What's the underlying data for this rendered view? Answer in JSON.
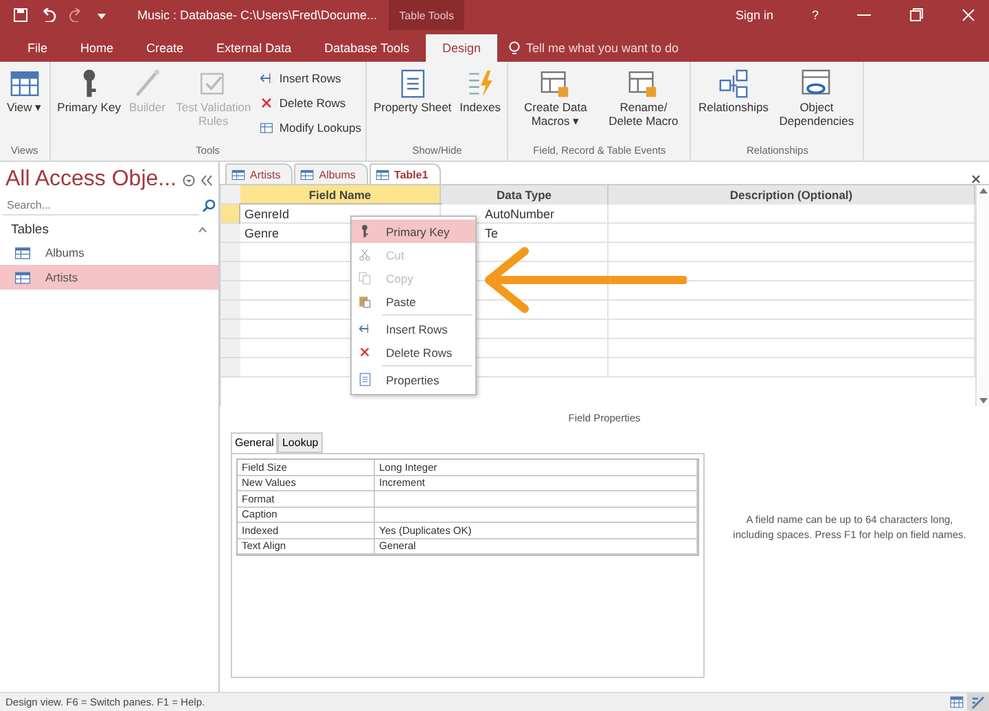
{
  "title_bar": {
    "title": "Music : Database- C:\\Users\\Fred\\Docume...",
    "context_label": "Table Tools",
    "sign_in": "Sign in",
    "help": "?"
  },
  "ribbon_tabs": [
    {
      "label": "File",
      "selected": false
    },
    {
      "label": "Home",
      "selected": false
    },
    {
      "label": "Create",
      "selected": false
    },
    {
      "label": "External Data",
      "selected": false
    },
    {
      "label": "Database Tools",
      "selected": false
    },
    {
      "label": "Design",
      "selected": true
    }
  ],
  "tell_me": "Tell me what you want to do",
  "ribbon_groups": [
    {
      "label": "Views",
      "buttons": [
        {
          "label": "View",
          "kind": "large",
          "disabled": false,
          "caret": "▾"
        }
      ]
    },
    {
      "label": "Tools",
      "buttons": [
        {
          "label": "Primary Key",
          "kind": "large",
          "disabled": false
        },
        {
          "label": "Builder",
          "kind": "large",
          "disabled": true
        },
        {
          "label": "Test Validation Rules",
          "kind": "large",
          "disabled": true
        },
        {
          "label": "Insert Rows",
          "kind": "small",
          "disabled": false
        },
        {
          "label": "Delete Rows",
          "kind": "small",
          "disabled": false
        },
        {
          "label": "Modify Lookups",
          "kind": "small",
          "disabled": false
        }
      ]
    },
    {
      "label": "Show/Hide",
      "buttons": [
        {
          "label": "Property Sheet",
          "kind": "large",
          "disabled": false
        },
        {
          "label": "Indexes",
          "kind": "large",
          "disabled": false
        }
      ]
    },
    {
      "label": "Field, Record & Table Events",
      "buttons": [
        {
          "label": "Create Data Macros",
          "kind": "large",
          "disabled": false,
          "caret": "▾"
        },
        {
          "label": "Rename/ Delete Macro",
          "kind": "large",
          "disabled": false
        }
      ]
    },
    {
      "label": "Relationships",
      "buttons": [
        {
          "label": "Relationships",
          "kind": "large",
          "disabled": false
        },
        {
          "label": "Object Dependencies",
          "kind": "large",
          "disabled": false
        }
      ]
    }
  ],
  "nav": {
    "title": "All Access Obje...",
    "search_placeholder": "Search...",
    "section": "Tables",
    "items": [
      {
        "label": "Albums",
        "selected": false
      },
      {
        "label": "Artists",
        "selected": true
      }
    ]
  },
  "doc_tabs": [
    {
      "label": "Artists",
      "selected": false
    },
    {
      "label": "Albums",
      "selected": false
    },
    {
      "label": "Table1",
      "selected": true
    }
  ],
  "columns": [
    "Field Name",
    "Data Type",
    "Description (Optional)"
  ],
  "rows": [
    {
      "field_name": "GenreId",
      "data_type": "AutoNumber",
      "selected": true
    },
    {
      "field_name": "Genre",
      "data_type": "Te",
      "selected": false
    }
  ],
  "context_menu": [
    {
      "kind": "item",
      "label": "Primary Key",
      "disabled": false,
      "selected": true
    },
    {
      "kind": "item",
      "label": "Cut",
      "disabled": true,
      "selected": false
    },
    {
      "kind": "item",
      "label": "Copy",
      "disabled": true,
      "selected": false
    },
    {
      "kind": "item",
      "label": "Paste",
      "disabled": false,
      "selected": false
    },
    {
      "kind": "separator"
    },
    {
      "kind": "item",
      "label": "Insert Rows",
      "disabled": false,
      "selected": false
    },
    {
      "kind": "item",
      "label": "Delete Rows",
      "disabled": false,
      "selected": false
    },
    {
      "kind": "separator"
    },
    {
      "kind": "item",
      "label": "Properties",
      "disabled": false,
      "selected": false
    }
  ],
  "field_properties": {
    "title": "Field Properties",
    "tabs": [
      {
        "label": "General",
        "selected": true
      },
      {
        "label": "Lookup",
        "selected": false
      }
    ],
    "rows": [
      {
        "label": "Field Size",
        "value": "Long Integer"
      },
      {
        "label": "New Values",
        "value": "Increment"
      },
      {
        "label": "Format",
        "value": ""
      },
      {
        "label": "Caption",
        "value": ""
      },
      {
        "label": "Indexed",
        "value": "Yes (Duplicates OK)"
      },
      {
        "label": "Text Align",
        "value": "General"
      }
    ],
    "help": "A field name can be up to 64 characters long, including spaces. Press F1 for help on field names."
  },
  "status_bar": "Design view.  F6 = Switch panes.  F1 = Help."
}
